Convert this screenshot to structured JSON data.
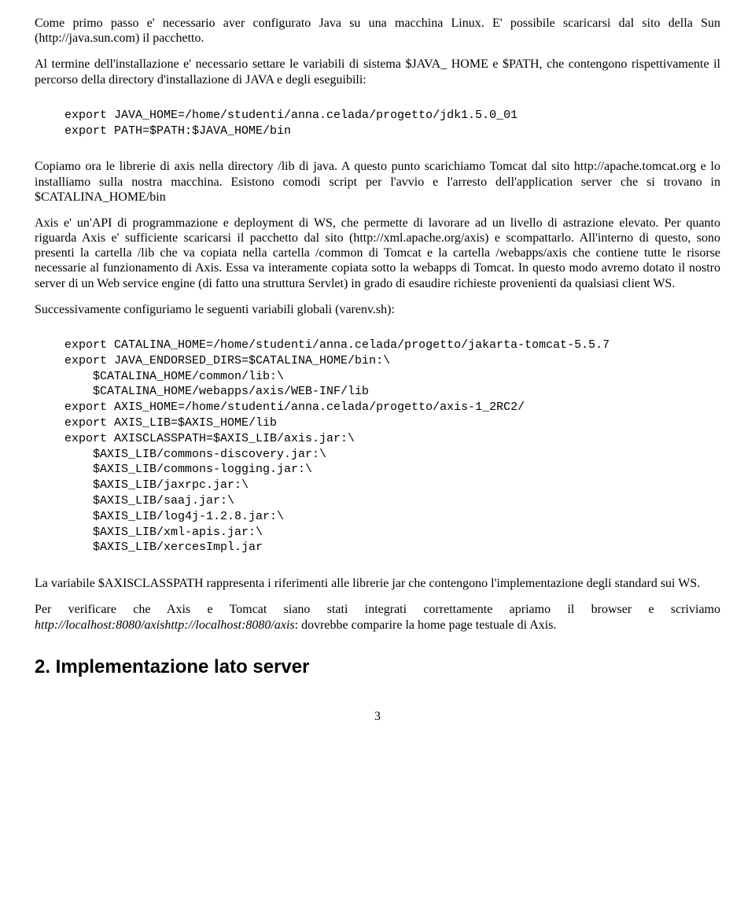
{
  "paragraphs": {
    "p1": "Come primo passo e' necessario aver configurato Java su una macchina Linux. E' possibile scaricarsi dal sito della Sun (http://java.sun.com) il pacchetto.",
    "p2": "Al termine dell'installazione e' necessario settare le variabili di sistema $JAVA_ HOME e $PATH, che contengono rispettivamente il percorso della directory d'installazione di JAVA e degli eseguibili:",
    "p3": "Copiamo ora le librerie di axis nella directory /lib di java.  A questo punto scarichiamo Tomcat dal sito http://apache.tomcat.org e lo installiamo sulla nostra macchina.  Esistono comodi script per l'avvio e l'arresto dell'application server che si trovano in $CATALINA_HOME/bin",
    "p4": "Axis e' un'API di programmazione e deployment di WS, che permette di lavorare ad un livello di astrazione elevato.  Per quanto riguarda Axis e' sufficiente scaricarsi il pacchetto dal sito (http://xml.apache.org/axis) e scompattarlo. All'interno di questo, sono presenti la cartella /lib che va copiata nella cartella /common di Tomcat e la cartella /webapps/axis che contiene tutte le risorse necessarie al funzionamento di Axis. Essa va interamente copiata sotto la webapps di Tomcat. In questo modo avremo dotato il nostro server di un Web service engine (di fatto una struttura Servlet) in grado di esaudire richieste provenienti da qualsiasi client WS.",
    "p5": "Successivamente configuriamo le seguenti variabili globali (varenv.sh):",
    "p6": "La variabile $AXISCLASSPATH rappresenta i riferimenti alle librerie jar che contengono l'implementazione degli standard sui WS.",
    "p7a": "Per verificare che Axis e Tomcat siano stati integrati correttamente apriamo il browser e scriviamo ",
    "p7italic": "http://localhost:8080/axishttp://localhost:8080/axis",
    "p7b": ": dovrebbe comparire la home page testuale di Axis."
  },
  "code": {
    "block1": "export JAVA_HOME=/home/studenti/anna.celada/progetto/jdk1.5.0_01\nexport PATH=$PATH:$JAVA_HOME/bin",
    "block2": "export CATALINA_HOME=/home/studenti/anna.celada/progetto/jakarta-tomcat-5.5.7\nexport JAVA_ENDORSED_DIRS=$CATALINA_HOME/bin:\\\n    $CATALINA_HOME/common/lib:\\\n    $CATALINA_HOME/webapps/axis/WEB-INF/lib\nexport AXIS_HOME=/home/studenti/anna.celada/progetto/axis-1_2RC2/\nexport AXIS_LIB=$AXIS_HOME/lib\nexport AXISCLASSPATH=$AXIS_LIB/axis.jar:\\\n    $AXIS_LIB/commons-discovery.jar:\\\n    $AXIS_LIB/commons-logging.jar:\\\n    $AXIS_LIB/jaxrpc.jar:\\\n    $AXIS_LIB/saaj.jar:\\\n    $AXIS_LIB/log4j-1.2.8.jar:\\\n    $AXIS_LIB/xml-apis.jar:\\\n    $AXIS_LIB/xercesImpl.jar"
  },
  "heading": "2. Implementazione lato server",
  "page_number": "3"
}
